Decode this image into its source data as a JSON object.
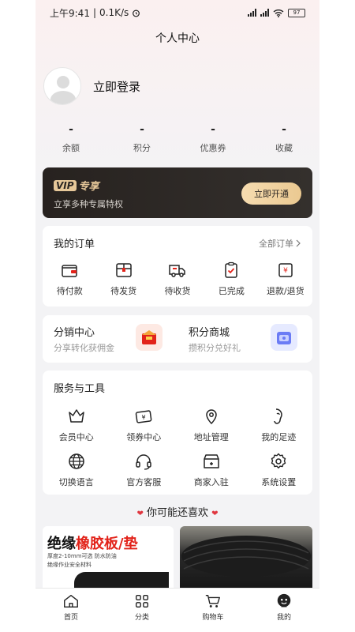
{
  "status_bar": {
    "time": "上午9:41",
    "speed": "0.1K/s",
    "battery": "97"
  },
  "page_title": "个人中心",
  "profile": {
    "login_text": "立即登录"
  },
  "stats": [
    {
      "value": "-",
      "label": "余额"
    },
    {
      "value": "-",
      "label": "积分"
    },
    {
      "value": "-",
      "label": "优惠券"
    },
    {
      "value": "-",
      "label": "收藏"
    }
  ],
  "vip": {
    "logo": "VIP",
    "title": "专享",
    "subtitle": "立享多种专属特权",
    "button": "立即开通"
  },
  "orders": {
    "title": "我的订单",
    "all_link": "全部订单",
    "items": [
      {
        "label": "待付款",
        "icon": "wallet-icon"
      },
      {
        "label": "待发货",
        "icon": "package-icon"
      },
      {
        "label": "待收货",
        "icon": "truck-icon"
      },
      {
        "label": "已完成",
        "icon": "clipboard-check-icon"
      },
      {
        "label": "退款/退货",
        "icon": "refund-icon"
      }
    ]
  },
  "promo": {
    "distribution": {
      "title": "分销中心",
      "subtitle": "分享转化获佣金"
    },
    "points_mall": {
      "title": "积分商城",
      "subtitle": "攒积分兑好礼"
    }
  },
  "services": {
    "title": "服务与工具",
    "items": [
      {
        "label": "会员中心",
        "icon": "crown-icon"
      },
      {
        "label": "领券中心",
        "icon": "coupon-icon"
      },
      {
        "label": "地址管理",
        "icon": "location-icon"
      },
      {
        "label": "我的足迹",
        "icon": "footprint-icon"
      },
      {
        "label": "切换语言",
        "icon": "globe-icon"
      },
      {
        "label": "官方客服",
        "icon": "headset-icon"
      },
      {
        "label": "商家入驻",
        "icon": "store-icon"
      },
      {
        "label": "系统设置",
        "icon": "gear-icon"
      }
    ]
  },
  "recommend": {
    "title": "你可能还喜欢",
    "products": [
      {
        "title_black": "绝缘",
        "title_red": "橡胶板/垫",
        "subtitle_line1": "厚度2-10mm可选 防水防油",
        "subtitle_line2": "绝缘作业安全材料"
      },
      {
        "image": "black-rubber-roll"
      }
    ]
  },
  "tabbar": [
    {
      "label": "首页",
      "icon": "home-icon"
    },
    {
      "label": "分类",
      "icon": "category-icon"
    },
    {
      "label": "购物车",
      "icon": "cart-icon"
    },
    {
      "label": "我的",
      "icon": "profile-icon"
    }
  ],
  "colors": {
    "accent_red": "#e2231a",
    "vip_gold": "#e7c89a",
    "vip_dark": "#27221f",
    "text_dark": "#222222"
  }
}
